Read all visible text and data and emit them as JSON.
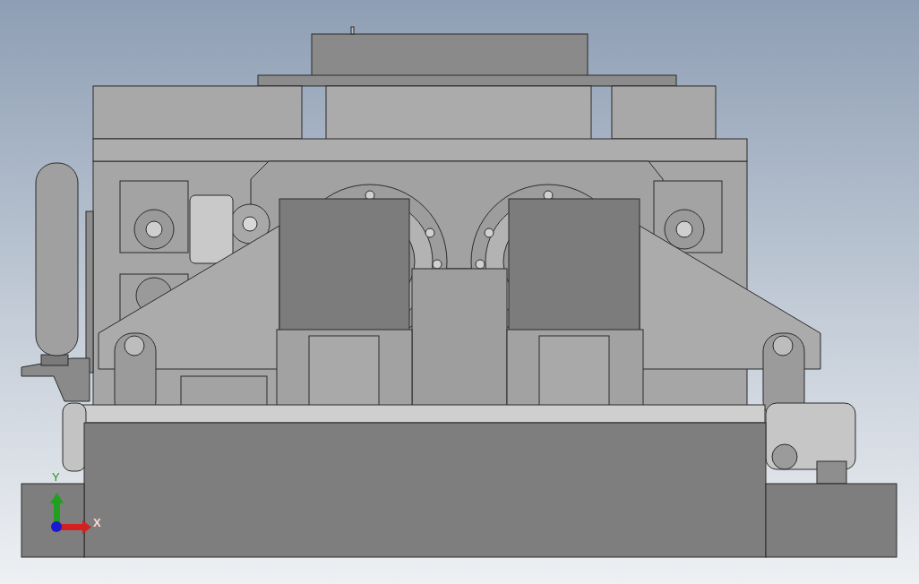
{
  "viewport": {
    "triad": {
      "y_label": "Y",
      "x_label": "X"
    }
  }
}
